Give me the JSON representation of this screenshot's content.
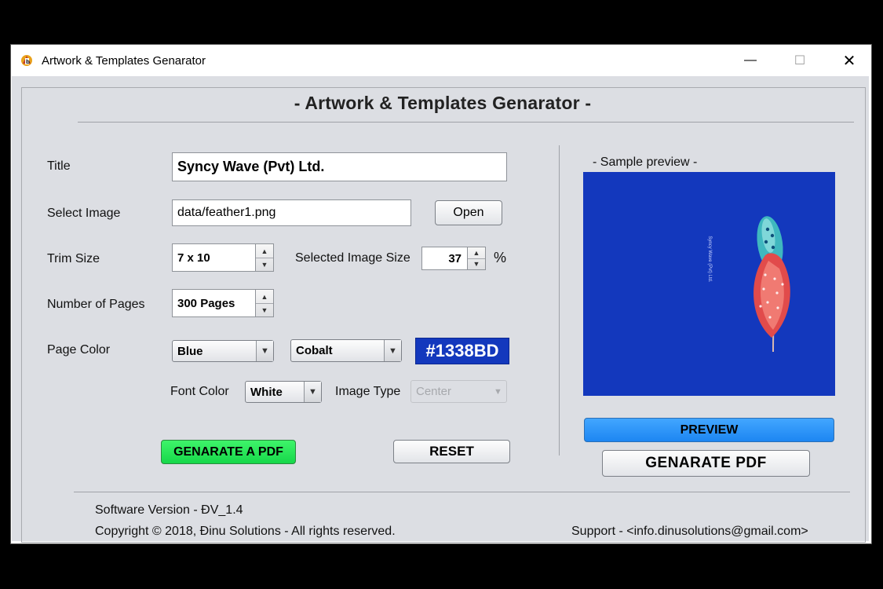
{
  "window": {
    "title": "Artwork & Templates Genarator",
    "controls": {
      "minimize": "—",
      "maximize": "☐",
      "close": "✕"
    }
  },
  "heading": "- Artwork & Templates Genarator -",
  "form": {
    "title_label": "Title",
    "title_value": "Syncy Wave (Pvt) Ltd.",
    "image_label": "Select Image",
    "image_path": "data/feather1.png",
    "open_button": "Open",
    "trim_label": "Trim Size",
    "trim_value": "7 x 10",
    "image_size_label": "Selected Image Size",
    "image_size_value": "37",
    "percent_sign": "%",
    "pages_label": "Number of Pages",
    "pages_value": "300 Pages",
    "page_color_label": "Page Color",
    "page_color_value": "Blue",
    "page_shade_value": "Cobalt",
    "color_hex": "#1338BD",
    "font_color_label": "Font Color",
    "font_color_value": "White",
    "image_type_label": "Image Type",
    "image_type_value": "Center",
    "generate_pdf_button": "GENARATE A PDF",
    "reset_button": "RESET"
  },
  "preview": {
    "label": "- Sample preview -",
    "cover_text": "Syncy Wave (Pvt) Ltd.",
    "background_color": "#1338BD",
    "preview_button": "PREVIEW",
    "generate_button": "GENARATE   PDF"
  },
  "footer": {
    "version": "Software Version - ĐV_1.4",
    "copyright": "Copyright © 2018, Đinu Solutions - All rights reserved.",
    "support": "Support - <info.dinusolutions@gmail.com>"
  },
  "colors": {
    "panel_bg": "#dcdee3",
    "accent_green": "#16d84a",
    "accent_blue": "#1d86f2",
    "page_blue": "#1338bd"
  }
}
